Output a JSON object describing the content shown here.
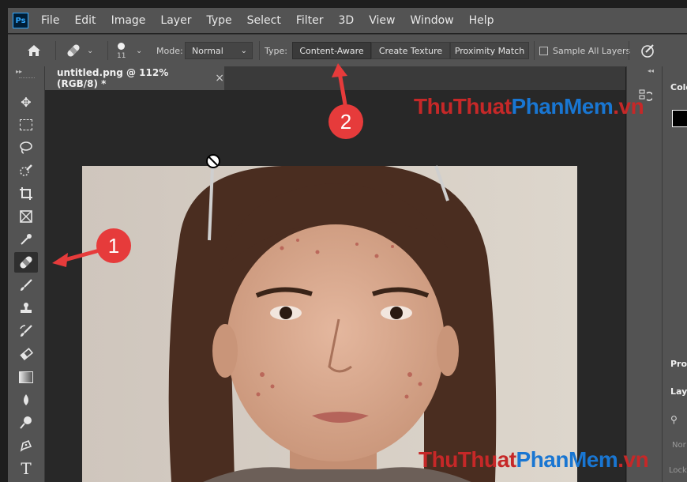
{
  "app": {
    "logo_text": "Ps"
  },
  "menu": [
    "File",
    "Edit",
    "Image",
    "Layer",
    "Type",
    "Select",
    "Filter",
    "3D",
    "View",
    "Window",
    "Help"
  ],
  "options": {
    "brush_size": "11",
    "mode_label": "Mode:",
    "mode_value": "Normal",
    "type_label": "Type:",
    "type_buttons": [
      "Content-Aware",
      "Create Texture",
      "Proximity Match"
    ],
    "sample_all_label": "Sample All Layers"
  },
  "document": {
    "tab_title": "untitled.png @ 112% (RGB/8) *",
    "close_glyph": "×"
  },
  "callouts": {
    "one": "1",
    "two": "2"
  },
  "watermark": {
    "part1": "ThuThuat",
    "part2": "PhanMem",
    "part3": ".vn"
  },
  "right_panels": {
    "color": "Colo",
    "properties": "Prop",
    "layers": "Laye",
    "filter_kind": "Nor",
    "lock": "Lock"
  },
  "colors": {
    "callout": "#e63b3b",
    "panel": "#535353",
    "canvas_bg": "#282828"
  }
}
